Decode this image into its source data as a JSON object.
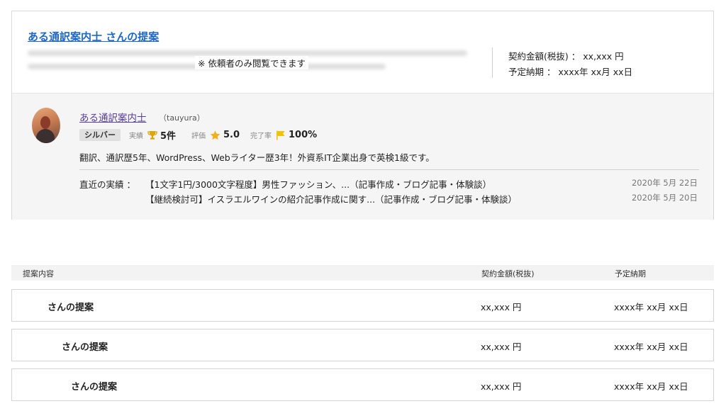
{
  "proposal": {
    "title": "ある通訳案内士 さんの提案",
    "restricted_note": "※ 依頼者のみ閲覧できます",
    "contract_amount": "契約金額(税抜) ： xx,xxx 円",
    "deadline": "予定納期 ： xxxx年 xx月 xx日"
  },
  "translator": {
    "name": "ある通訳案内士",
    "handle": "（tauyura）",
    "rank_badge": "シルバー",
    "stats": {
      "jisseki_label": "実績",
      "jisseki_value": "5件",
      "hyoka_label": "評価",
      "hyoka_value": "5.0",
      "kanryo_label": "完了率",
      "kanryo_value": "100%"
    },
    "bio": "翻訳、通訳歴5年、WordPress、Webライター歴3年！外資系IT企業出身で英検1級です。",
    "recent_label": "直近の実績 ：",
    "recent_works": [
      {
        "title": "【1文字1円/3000文字程度】男性ファッション、...（記事作成・ブログ記事・体験談）",
        "date": "2020年 5月 22日"
      },
      {
        "title": "【継続検討可】イスラエルワインの紹介記事作成に関す...（記事作成・ブログ記事・体験談）",
        "date": "2020年 5月 20日"
      }
    ]
  },
  "list": {
    "headers": {
      "content": "提案内容",
      "amount": "契約金額(税抜)",
      "deadline": "予定納期"
    },
    "rows": [
      {
        "title": "さんの提案",
        "amount": "xx,xxx 円",
        "deadline": "xxxx年 xx月 xx日"
      },
      {
        "title": "さんの提案",
        "amount": "xx,xxx 円",
        "deadline": "xxxx年 xx月 xx日"
      },
      {
        "title": "さんの提案",
        "amount": "xx,xxx 円",
        "deadline": "xxxx年 xx月 xx日"
      }
    ]
  },
  "colors": {
    "link_blue": "#1f67c7",
    "name_purple": "#5a3e9b",
    "trophy": "#e0a500",
    "star": "#f2b01e",
    "flag": "#f2c200"
  },
  "icons": [
    "trophy-icon",
    "star-icon",
    "flag-icon"
  ]
}
